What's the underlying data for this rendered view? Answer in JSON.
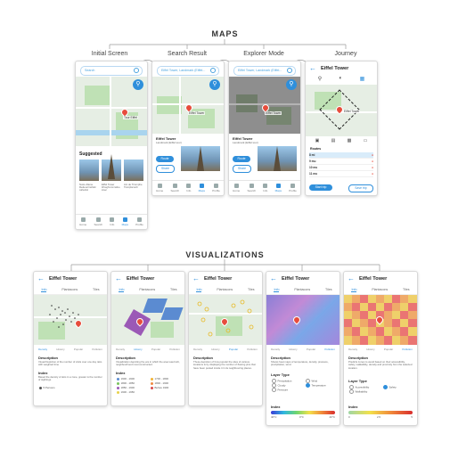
{
  "colors": {
    "accent": "#2f8fdb",
    "pin": "#e74c3c"
  },
  "maps": {
    "title": "MAPS",
    "columns": [
      {
        "label": "Initial Screen",
        "search_placeholder": "Search",
        "pin_label": "Tour Eiffel",
        "suggested_title": "Suggested",
        "suggestions": [
          {
            "name": "Notre-Dame",
            "desc": "Medieval Catholic cathedral"
          },
          {
            "name": "Eiffel Tower",
            "desc": "Wrought-iron lattice tower"
          },
          {
            "name": "Arc de Triomphe",
            "desc": "Triumphal arch"
          }
        ],
        "tabs": [
          "Home",
          "Search",
          "Info",
          "Maps",
          "Profile"
        ],
        "active_tab": 3
      },
      {
        "label": "Search Result",
        "search_value": "Eiffel Tower, Landmark (Eiffel...",
        "pin_label": "Eiffel Tower",
        "place_name": "Eiffel Tower",
        "place_sub": "Landmark (Eiffel tour)",
        "btn_route": "Route",
        "btn_share": "Share",
        "tabs": [
          "Home",
          "Search",
          "Info",
          "Maps",
          "Profile"
        ],
        "active_tab": 3
      },
      {
        "label": "Explorer Mode",
        "search_value": "Eiffel Tower, Landmark (Eiffel...",
        "pin_label": "Eiffel Tower",
        "place_name": "Eiffel Tower",
        "place_sub": "Landmark (Eiffel tour)",
        "btn_route": "Route",
        "btn_share": "Share",
        "tabs": [
          "Home",
          "Search",
          "Info",
          "Maps",
          "Profile"
        ],
        "active_tab": 3
      },
      {
        "label": "Journey",
        "title": "Eiffel Tower",
        "pin_label": "Eiffel Tower",
        "section": "Routes",
        "routes": [
          {
            "time": "8 mi",
            "meta": "",
            "extra": ""
          },
          {
            "time": "9 mu",
            "meta": "",
            "extra": ""
          },
          {
            "time": "10 mu",
            "meta": "",
            "extra": ""
          },
          {
            "time": "11 mu",
            "meta": "",
            "extra": ""
          }
        ],
        "btn_start": "Start trip",
        "btn_save": "Save trip"
      }
    ]
  },
  "visualizations": {
    "title": "VISUALIZATIONS",
    "screens": [
      {
        "title": "Eiffel Tower",
        "tabs": [
          "Info",
          "Plantacons",
          "Tiles"
        ],
        "active_tab": 0,
        "subtabs": [
          "Density",
          "History",
          "Popular",
          "Pollution"
        ],
        "active_subtab": 0,
        "description_title": "Description",
        "description": "Visual Depiction of the number of visits over one day ratio with weighted time",
        "index_title": "Index",
        "index_text": "Based the density of dots in a zone, greater is the number of sightings.",
        "legend": [
          {
            "label": "5 Persons",
            "color": "#555555"
          }
        ]
      },
      {
        "title": "Eiffel Tower",
        "tabs": [
          "Info",
          "Plantacons",
          "Tiles"
        ],
        "active_tab": 0,
        "subtabs": [
          "Density",
          "History",
          "Popular",
          "Pollution"
        ],
        "active_subtab": 1,
        "description_title": "Description",
        "description": "Visualization depicting the era in which the area was built, neighbourhood most constructed.",
        "index_title": "Index",
        "legend": [
          {
            "label": "1900 - 1900",
            "color": "#5b8bd1"
          },
          {
            "label": "1700 - 1800",
            "color": "#f2b233"
          },
          {
            "label": "1800 - 1850",
            "color": "#7bc35c"
          },
          {
            "label": "1800 - 1900",
            "color": "#f08a43"
          },
          {
            "label": "1850 - 1900",
            "color": "#9b59b6"
          },
          {
            "label": "Before 1900",
            "color": "#d94a4a"
          },
          {
            "label": "1900 - 1950",
            "color": "#e8d24a"
          }
        ]
      },
      {
        "title": "Eiffel Tower",
        "tabs": [
          "Info",
          "Plantacons",
          "Tiles"
        ],
        "active_tab": 0,
        "subtabs": [
          "Density",
          "History",
          "Popular",
          "Pollution"
        ],
        "active_subtab": 2,
        "description_title": "Description",
        "description": "These depiction of how popular the sites of various locations is by displaying the number of flowing pins that have been posted inside it in its neighbouring places."
      },
      {
        "title": "Eiffel Tower",
        "tabs": [
          "Info",
          "Plantacons",
          "Tiles"
        ],
        "active_tab": 0,
        "subtabs": [
          "Density",
          "History",
          "Popular",
          "Pollution"
        ],
        "active_subtab": 3,
        "description_title": "Description",
        "description": "Shows heat maps of temperature, density, pressure, precipitation, wind.",
        "layer_title": "Layer Type",
        "layers": [
          "Precipitation",
          "Wind",
          "Cloudy",
          "Temperature",
          "Pressure"
        ],
        "index_title": "Index",
        "index_min": "40°C",
        "index_mid": "0°C",
        "index_max": "40°C"
      },
      {
        "title": "Eiffel Tower",
        "tabs": [
          "Info",
          "Plantacons",
          "Tiles"
        ],
        "active_tab": 0,
        "subtabs": [
          "Density",
          "History",
          "Popular",
          "Pollution"
        ],
        "active_subtab": 3,
        "description_title": "Description",
        "description": "Predicts zones to avoid based on their accessibility, safety, walkability, density and proximity from the selected location.",
        "layer_title": "Layer Type",
        "layers": [
          "Accessibility",
          "Safety",
          "Walkability"
        ],
        "index_title": "Index",
        "index_min": "0",
        "index_mid": "2.5",
        "index_max": "5"
      }
    ]
  }
}
